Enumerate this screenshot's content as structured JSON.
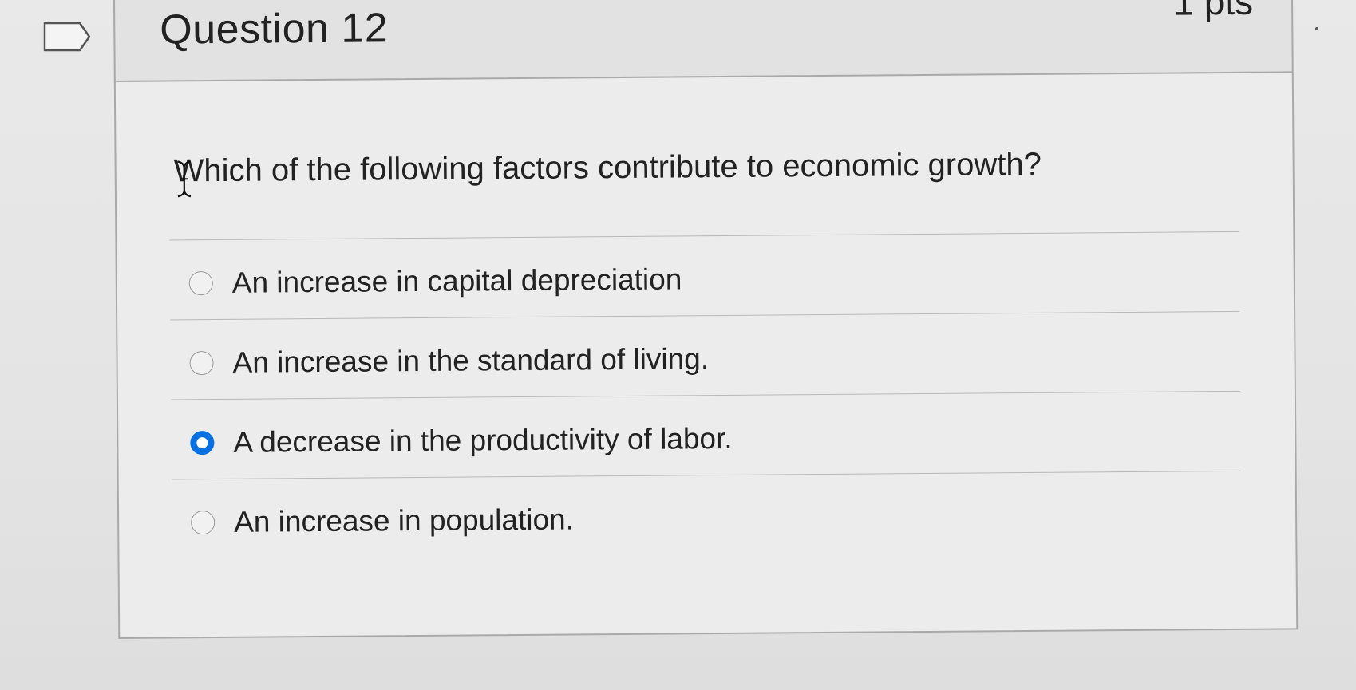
{
  "question": {
    "title": "Question 12",
    "points": "1 pts",
    "text": "Which of the following factors contribute to economic growth?"
  },
  "answers": [
    {
      "label": "An increase in capital depreciation",
      "selected": false
    },
    {
      "label": "An increase in the standard of living.",
      "selected": false
    },
    {
      "label": "A decrease in the productivity of labor.",
      "selected": true
    },
    {
      "label": "An increase in population.",
      "selected": false
    }
  ],
  "icons": {
    "flag": "flag-question-icon",
    "cursor": "text-cursor-icon"
  },
  "colors": {
    "selected_radio": "#0770e3",
    "background": "#e6e6e6"
  }
}
